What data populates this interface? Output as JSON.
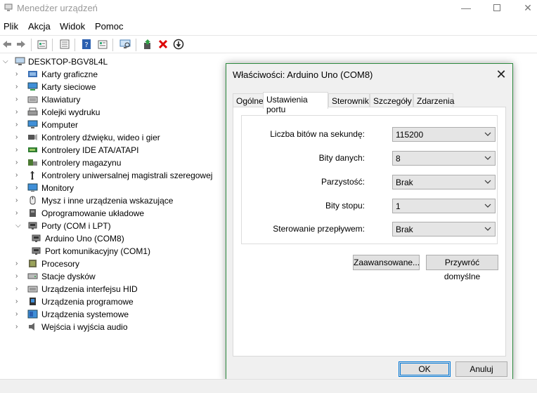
{
  "window": {
    "title": "Menedżer urządzeń"
  },
  "menu": [
    "Plik",
    "Akcja",
    "Widok",
    "Pomoc"
  ],
  "toolbar": {
    "icons": [
      "back-icon",
      "forward-icon",
      "properties-icon",
      "details-icon",
      "help-icon",
      "view-icon",
      "scan-icon",
      "update-driver-icon",
      "uninstall-icon",
      "disable-icon"
    ]
  },
  "tree": {
    "root": "DESKTOP-BGV8L4L",
    "items": [
      {
        "label": "Karty graficzne",
        "icon": "display-adapter-icon"
      },
      {
        "label": "Karty sieciowe",
        "icon": "network-adapter-icon"
      },
      {
        "label": "Klawiatury",
        "icon": "keyboard-icon"
      },
      {
        "label": "Kolejki wydruku",
        "icon": "printer-icon"
      },
      {
        "label": "Komputer",
        "icon": "computer-icon"
      },
      {
        "label": "Kontrolery dźwięku, wideo i gier",
        "icon": "sound-icon"
      },
      {
        "label": "Kontrolery IDE ATA/ATAPI",
        "icon": "ide-icon"
      },
      {
        "label": "Kontrolery magazynu",
        "icon": "storage-icon"
      },
      {
        "label": "Kontrolery uniwersalnej magistrali szeregowej",
        "icon": "usb-icon"
      },
      {
        "label": "Monitory",
        "icon": "monitor-icon"
      },
      {
        "label": "Mysz i inne urządzenia wskazujące",
        "icon": "mouse-icon"
      },
      {
        "label": "Oprogramowanie układowe",
        "icon": "firmware-icon"
      },
      {
        "label": "Porty (COM i LPT)",
        "icon": "port-icon"
      },
      {
        "label": "Arduino Uno (COM8)",
        "icon": "port-device-icon"
      },
      {
        "label": "Port komunikacyjny (COM1)",
        "icon": "port-device-icon"
      },
      {
        "label": "Procesory",
        "icon": "processor-icon"
      },
      {
        "label": "Stacje dysków",
        "icon": "disk-icon"
      },
      {
        "label": "Urządzenia interfejsu HID",
        "icon": "hid-icon"
      },
      {
        "label": "Urządzenia programowe",
        "icon": "software-device-icon"
      },
      {
        "label": "Urządzenia systemowe",
        "icon": "system-device-icon"
      },
      {
        "label": "Wejścia i wyjścia audio",
        "icon": "audio-io-icon"
      }
    ]
  },
  "dialog": {
    "title": "Właściwości: Arduino Uno (COM8)",
    "tabs": [
      "Ogólne",
      "Ustawienia portu",
      "Sterownik",
      "Szczegóły",
      "Zdarzenia"
    ],
    "active_tab": "Ustawienia portu",
    "fields": [
      {
        "label": "Liczba bitów na sekundę:",
        "value": "115200"
      },
      {
        "label": "Bity danych:",
        "value": "8"
      },
      {
        "label": "Parzystość:",
        "value": "Brak"
      },
      {
        "label": "Bity stopu:",
        "value": "1"
      },
      {
        "label": "Sterowanie przepływem:",
        "value": "Brak"
      }
    ],
    "advanced_label": "Zaawansowane...",
    "defaults_label": "Przywróć domyślne",
    "ok_label": "OK",
    "cancel_label": "Anuluj"
  },
  "colors": {
    "accent": "#0078d7",
    "dialog_border": "#2b8a3e"
  }
}
